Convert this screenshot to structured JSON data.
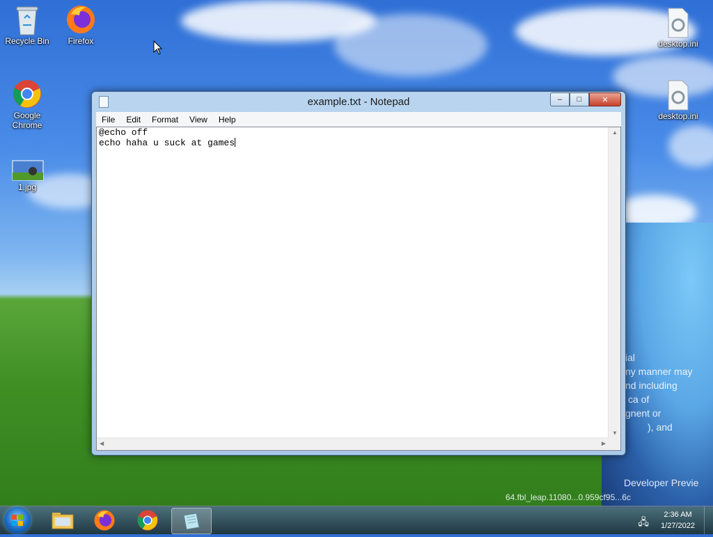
{
  "desktop": {
    "icons_left": [
      {
        "label": "Recycle Bin",
        "icon": "recycle-bin-icon"
      },
      {
        "label": "Firefox",
        "icon": "firefox-icon"
      },
      {
        "label": "Google Chrome",
        "icon": "chrome-icon"
      },
      {
        "label": "1.jpg",
        "icon": "image-file-icon"
      }
    ],
    "icons_right": [
      {
        "label": "desktop.ini",
        "icon": "settings-file-icon"
      },
      {
        "label": "desktop.ini",
        "icon": "settings-file-icon"
      }
    ],
    "wallpaper_text": [
      "ial",
      "ny manner may",
      "nd including",
      "ca of",
      "gnent or",
      "), and",
      "Developer Previe",
      "64.fbl_leap.11080...0.959cf95...6c"
    ]
  },
  "window": {
    "title": "example.txt - Notepad",
    "menu": [
      "File",
      "Edit",
      "Format",
      "View",
      "Help"
    ],
    "content_lines": [
      "@echo off",
      "echo haha u suck at games"
    ],
    "buttons": {
      "minimize": "–",
      "maximize": "□",
      "close": "✕"
    }
  },
  "taskbar": {
    "items": [
      {
        "name": "file-explorer",
        "icon": "folder-icon"
      },
      {
        "name": "firefox",
        "icon": "firefox-icon"
      },
      {
        "name": "chrome",
        "icon": "chrome-icon"
      },
      {
        "name": "notepad",
        "icon": "notepad-icon",
        "active": true
      }
    ],
    "time": "2:36 AM",
    "date": "1/27/2022"
  }
}
